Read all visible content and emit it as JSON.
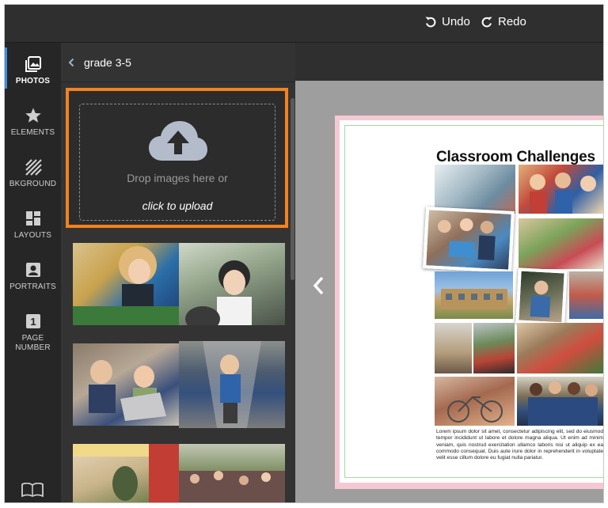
{
  "toolbar": {
    "undo_label": "Undo",
    "redo_label": "Redo"
  },
  "rail": {
    "items": [
      {
        "label": "PHOTOS",
        "icon": "photos-icon",
        "active": true
      },
      {
        "label": "ELEMENTS",
        "icon": "star-icon",
        "active": false
      },
      {
        "label": "BKGROUND",
        "icon": "background-icon",
        "active": false
      },
      {
        "label": "LAYOUTS",
        "icon": "layouts-icon",
        "active": false
      },
      {
        "label": "PORTRAITS",
        "icon": "portrait-icon",
        "active": false
      },
      {
        "label": "PAGE",
        "label2": "NUMBER",
        "icon": "page-number-icon",
        "badge": "1",
        "active": false
      }
    ],
    "bottom_icon": "book-icon"
  },
  "panel": {
    "folder_title": "grade 3-5",
    "upload": {
      "drop_text": "Drop images here or",
      "link_text": "click to upload"
    }
  },
  "page": {
    "title": "Classroom Challenges",
    "body_text": "Lorem ipsum dolor sit amet, consectetur adipiscing elit, sed do eiusmod tempor incididunt ut labore et dolore magna aliqua. Ut enim ad minim veniam, quis nostrud exercitation ullamco laboris nisi ut aliquip ex ea commodo consequat. Duis aute irure dolor in reprehenderit in voluptate velit esse cillum dolore eu fugiat nulla pariatur."
  },
  "colors": {
    "accent_orange": "#f28220",
    "active_indicator": "#3b8fe0",
    "panel_bg": "#333333",
    "canvas_bg": "#9e9e9e"
  }
}
